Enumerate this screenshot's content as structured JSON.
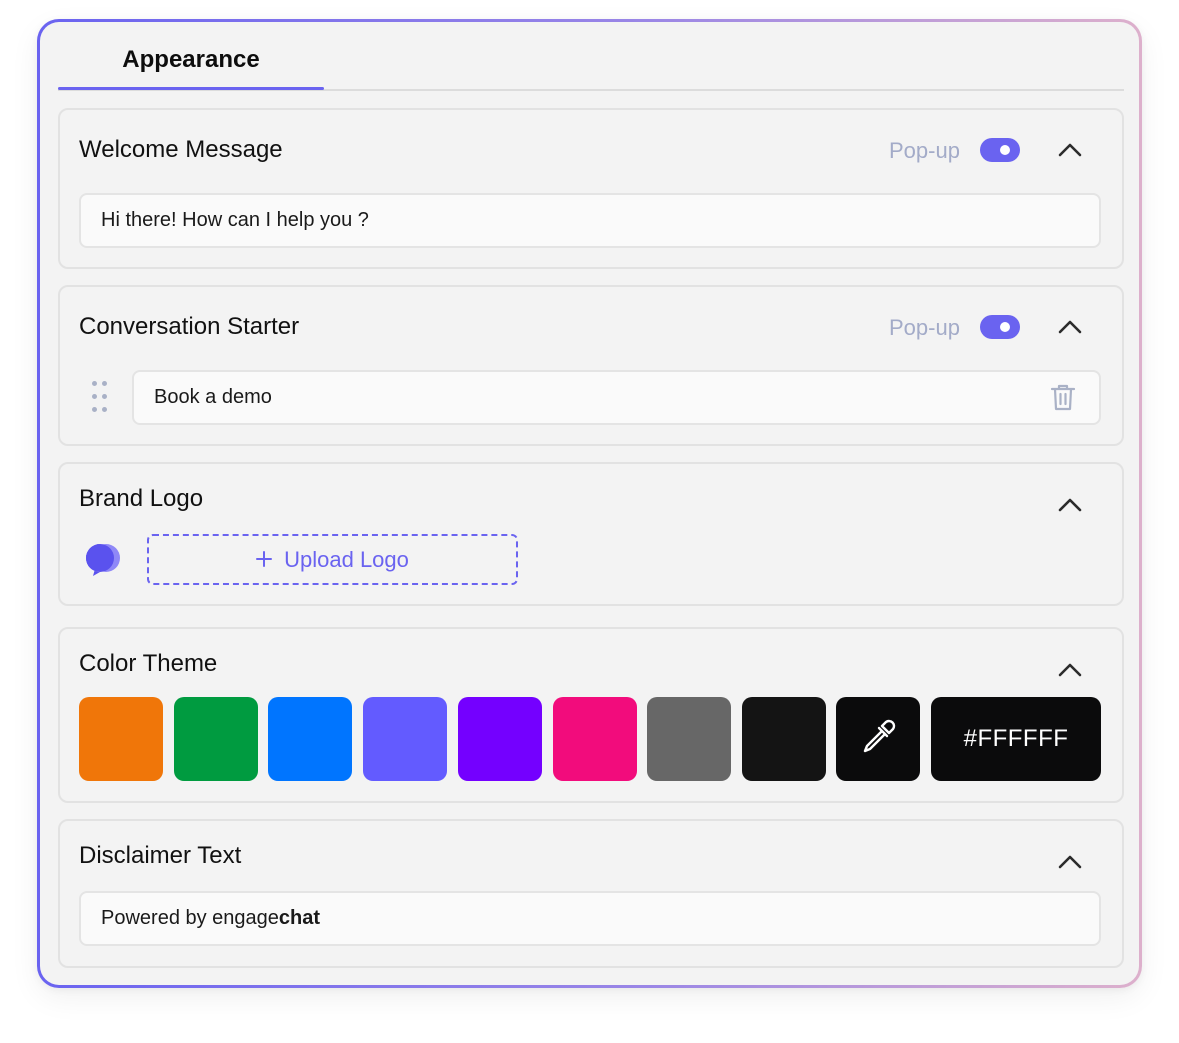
{
  "tabs": [
    {
      "label": "Appearance",
      "active": true
    }
  ],
  "accent_color": "#6A63F0",
  "welcome": {
    "title": "Welcome Message",
    "popup_label": "Pop-up",
    "popup_enabled": true,
    "message": "Hi there! How can I help you ?",
    "expanded": true
  },
  "starter": {
    "title": "Conversation Starter",
    "popup_label": "Pop-up",
    "popup_enabled": true,
    "items": [
      "Book a demo"
    ],
    "expanded": true
  },
  "logo": {
    "title": "Brand Logo",
    "upload_label": "Upload Logo",
    "expanded": true
  },
  "theme": {
    "title": "Color Theme",
    "swatches": [
      "#F07609",
      "#009B40",
      "#0075FF",
      "#635BFF",
      "#7400FF",
      "#F20C7C",
      "#676767",
      "#141414"
    ],
    "picker_icon": "eyedropper-icon",
    "hex_value": "#FFFFFF",
    "expanded": true
  },
  "disclaimer": {
    "title": "Disclaimer Text",
    "prefix": "Powered by engage",
    "brand_bold": "chat",
    "expanded": true
  }
}
